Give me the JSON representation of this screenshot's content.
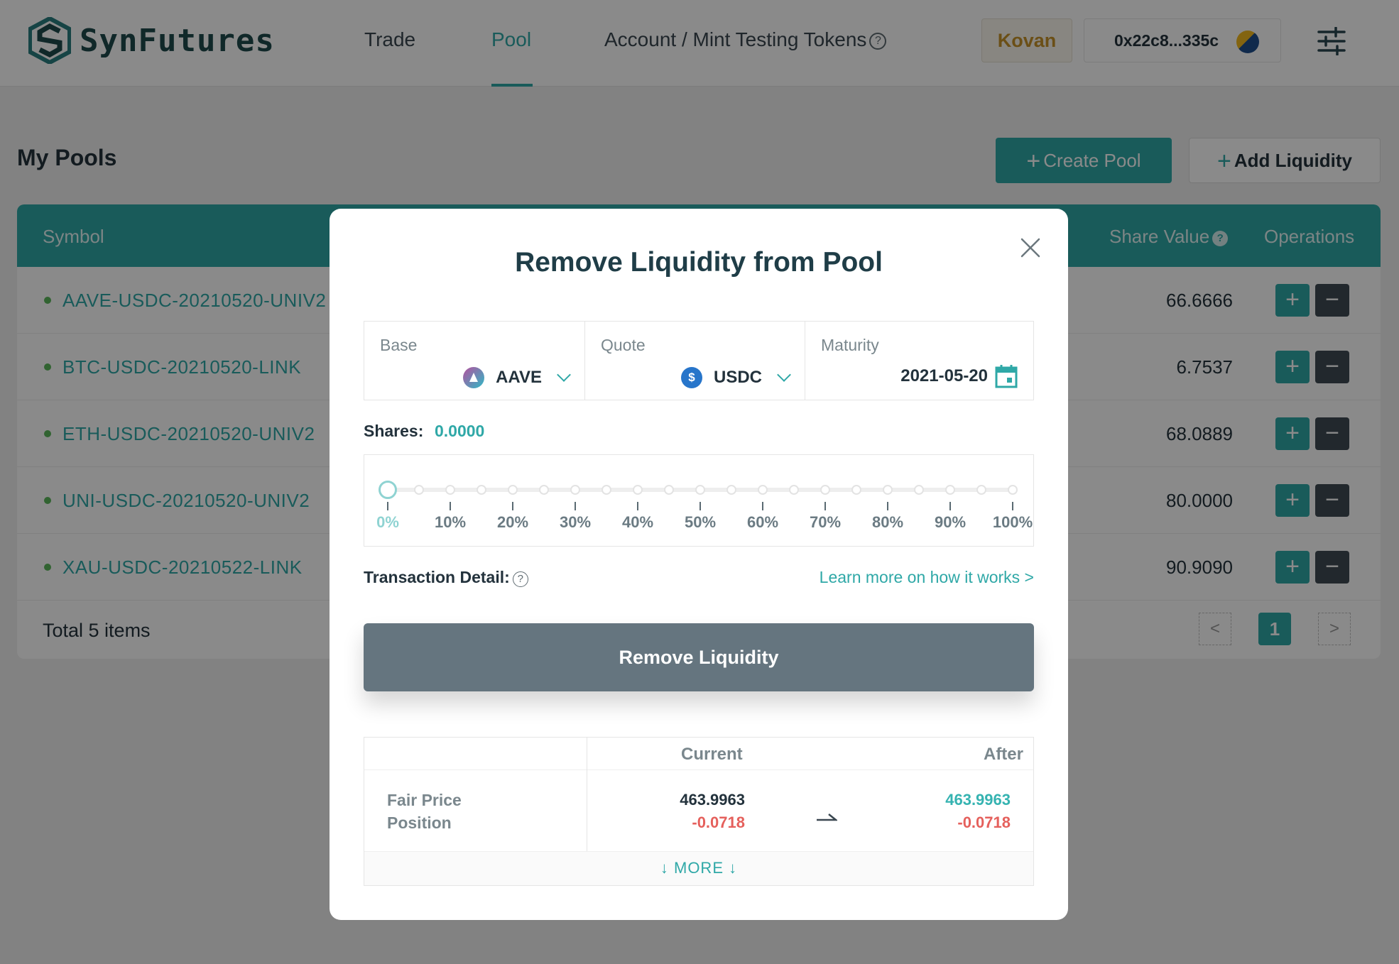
{
  "header": {
    "brand": "SynFutures",
    "nav": [
      {
        "label": "Trade"
      },
      {
        "label": "Pool"
      },
      {
        "label": "Account / Mint Testing Tokens"
      }
    ],
    "help_glyph": "?",
    "network": "Kovan",
    "wallet": "0x22c8...335c"
  },
  "page": {
    "title": "My Pools",
    "create_label": "Create Pool",
    "add_label": "Add Liquidity",
    "plus_glyph": "+"
  },
  "table": {
    "columns": {
      "symbol": "Symbol",
      "share_value": "Share Value",
      "operations": "Operations"
    },
    "rows": [
      {
        "symbol": "AAVE-USDC-20210520-UNIV2",
        "share_value": "66.6666"
      },
      {
        "symbol": "BTC-USDC-20210520-LINK",
        "share_value": "6.7537"
      },
      {
        "symbol": "ETH-USDC-20210520-UNIV2",
        "share_value": "68.0889"
      },
      {
        "symbol": "UNI-USDC-20210520-UNIV2",
        "share_value": "80.0000"
      },
      {
        "symbol": "XAU-USDC-20210522-LINK",
        "share_value": "90.9090"
      }
    ],
    "op_plus": "+",
    "op_minus": "−",
    "total": "Total 5 items",
    "pagination": {
      "prev": "<",
      "current": "1",
      "next": ">"
    }
  },
  "modal": {
    "title": "Remove Liquidity from Pool",
    "base": {
      "label": "Base",
      "value": "AAVE"
    },
    "quote": {
      "label": "Quote",
      "value": "USDC"
    },
    "maturity": {
      "label": "Maturity",
      "value": "2021-05-20"
    },
    "shares_label": "Shares:",
    "shares_value": "0.0000",
    "slider": {
      "value_percent": 0,
      "ticks": [
        "0%",
        "10%",
        "20%",
        "30%",
        "40%",
        "50%",
        "60%",
        "70%",
        "80%",
        "90%",
        "100%"
      ]
    },
    "transaction_detail_label": "Transaction Detail:",
    "learn_more": "Learn more on how it works >",
    "remove_button": "Remove Liquidity",
    "detail": {
      "col_current": "Current",
      "col_after": "After",
      "row_label_1": "Fair Price",
      "row_label_2": "Position",
      "current_price": "463.9963",
      "current_position": "-0.0718",
      "after_price": "463.9963",
      "after_position": "-0.0718",
      "more": "↓ MORE ↓"
    }
  },
  "colors": {
    "accent": "#2fa8a7",
    "dark_button": "#3f4b53",
    "negative": "#e5605c",
    "network": "#c6932a"
  },
  "icons": [
    "logo-icon",
    "help-icon",
    "settings-icon",
    "close-icon",
    "calendar-icon",
    "chevron-down-icon",
    "aave-coin-icon",
    "usdc-coin-icon",
    "arrow-right-icon",
    "wallet-avatar"
  ]
}
